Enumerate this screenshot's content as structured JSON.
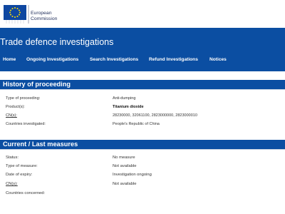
{
  "header": {
    "logo_line1": "European",
    "logo_line2": "Commission",
    "site_title": "Trade defence investigations"
  },
  "nav": [
    {
      "label": "Home"
    },
    {
      "label": "Ongoing Investigations"
    },
    {
      "label": "Search Investigations"
    },
    {
      "label": "Refund Investigations"
    },
    {
      "label": "Notices"
    }
  ],
  "history": {
    "title": "History of proceeding",
    "rows": [
      {
        "label": "Type of proceeding:",
        "value": "Anti-dumping"
      },
      {
        "label": "Product(s):",
        "value": "Titanium dioxide"
      },
      {
        "label": "CN(s):",
        "value": "28230000, 32061100, 2823000000, 2823000010"
      },
      {
        "label": "Countries investigated:",
        "value": "People's Republic of China"
      }
    ]
  },
  "current": {
    "title": "Current / Last measures",
    "rows": [
      {
        "label": "Status:",
        "value": "No measure"
      },
      {
        "label": "Type of measure:",
        "value": "Not available"
      },
      {
        "label": "Date of expiry:",
        "value": "Investigation ongoing"
      },
      {
        "label": "CN(s):",
        "value": "Not available"
      },
      {
        "label": "Countries concerned:",
        "value": ""
      }
    ]
  },
  "colors": {
    "brand_blue": "#0b4ea2",
    "eu_flag_blue": "#0e47a1",
    "eu_star_yellow": "#ffdd00"
  }
}
